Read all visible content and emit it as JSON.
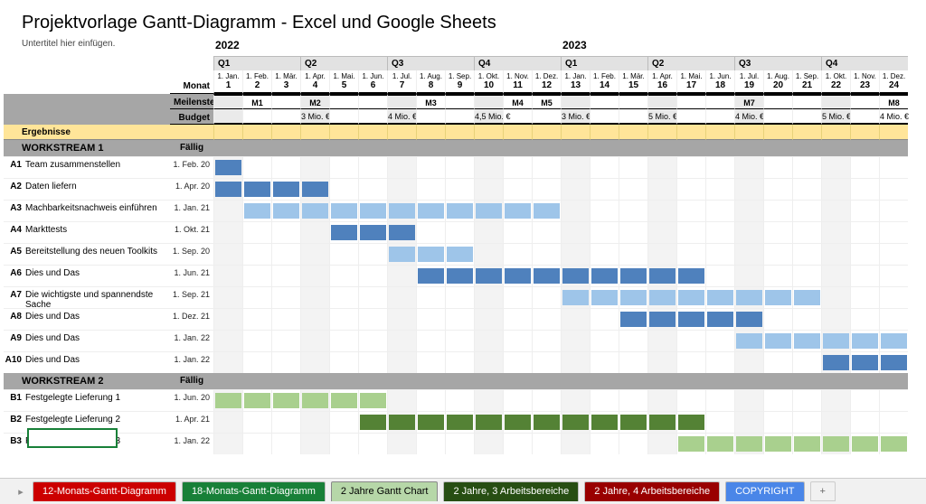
{
  "title": "Projektvorlage Gantt-Diagramm - Excel und Google Sheets",
  "subtitle": "Untertitel hier einfügen.",
  "header": {
    "monat_label": "Monat",
    "meilenstein_label": "Meilenstein",
    "budget_label": "Budget",
    "ergebnisse_label": "Ergebnisse",
    "faellig_label": "Fällig",
    "years": [
      "2022",
      "2023"
    ],
    "quarters": [
      "Q1",
      "Q2",
      "Q3",
      "Q4",
      "Q1",
      "Q2",
      "Q3",
      "Q4"
    ],
    "month_labels": [
      "1. Jan.",
      "1. Feb.",
      "1. Mär.",
      "1. Apr.",
      "1. Mai.",
      "1. Jun.",
      "1. Jul.",
      "1. Aug.",
      "1. Sep.",
      "1. Okt.",
      "1. Nov.",
      "1. Dez.",
      "1. Jan.",
      "1. Feb.",
      "1. Mär.",
      "1. Apr.",
      "1. Mai.",
      "1. Jun.",
      "1. Jul.",
      "1. Aug.",
      "1. Sep.",
      "1. Okt.",
      "1. Nov.",
      "1. Dez."
    ],
    "month_idx": [
      "1",
      "2",
      "3",
      "4",
      "5",
      "6",
      "7",
      "8",
      "9",
      "10",
      "11",
      "12",
      "13",
      "14",
      "15",
      "16",
      "17",
      "18",
      "19",
      "20",
      "21",
      "22",
      "23",
      "24"
    ]
  },
  "milestones": {
    "2": "M1",
    "4": "M2",
    "8": "M3",
    "11": "M4",
    "12": "M5",
    "19": "M7",
    "24": "M8"
  },
  "budget": {
    "4": "3 Mio. €",
    "7": "4 Mio. €",
    "10": "4,5 Mio. €",
    "13": "3 Mio. €",
    "16": "5 Mio. €",
    "19": "4 Mio. €",
    "22": "5 Mio. €",
    "24": "4 Mio. €"
  },
  "workstreams": [
    {
      "name": "WORKSTREAM 1",
      "tasks": [
        {
          "id": "A1",
          "name": "Team zusammenstellen",
          "due": "1. Feb. 20",
          "bars": [
            {
              "start": 1,
              "end": 1,
              "color": "blue-dark"
            }
          ]
        },
        {
          "id": "A2",
          "name": "Daten liefern",
          "due": "1. Apr. 20",
          "bars": [
            {
              "start": 1,
              "end": 4,
              "color": "blue-dark"
            }
          ]
        },
        {
          "id": "A3",
          "name": "Machbarkeitsnachweis einführen",
          "due": "1. Jan. 21",
          "bars": [
            {
              "start": 2,
              "end": 12,
              "color": "blue-light"
            }
          ]
        },
        {
          "id": "A4",
          "name": "Markttests",
          "due": "1. Okt. 21",
          "bars": [
            {
              "start": 5,
              "end": 7,
              "color": "blue-dark"
            }
          ]
        },
        {
          "id": "A5",
          "name": "Bereitstellung des neuen Toolkits",
          "due": "1. Sep. 20",
          "bars": [
            {
              "start": 7,
              "end": 9,
              "color": "blue-light"
            }
          ]
        },
        {
          "id": "A6",
          "name": "Dies und Das",
          "due": "1. Jun. 21",
          "bars": [
            {
              "start": 8,
              "end": 17,
              "color": "blue-dark"
            }
          ]
        },
        {
          "id": "A7",
          "name": "Die wichtigste und spannendste Sache",
          "due": "1. Sep. 21",
          "bars": [
            {
              "start": 13,
              "end": 21,
              "color": "blue-light"
            }
          ]
        },
        {
          "id": "A8",
          "name": "Dies und Das",
          "due": "1. Dez. 21",
          "bars": [
            {
              "start": 15,
              "end": 19,
              "color": "blue-dark"
            }
          ]
        },
        {
          "id": "A9",
          "name": "Dies und Das",
          "due": "1. Jan. 22",
          "bars": [
            {
              "start": 19,
              "end": 24,
              "color": "blue-light"
            }
          ]
        },
        {
          "id": "A10",
          "name": "Dies und Das",
          "due": "1. Jan. 22",
          "bars": [
            {
              "start": 22,
              "end": 24,
              "color": "blue-dark"
            }
          ]
        }
      ]
    },
    {
      "name": "WORKSTREAM 2",
      "tasks": [
        {
          "id": "B1",
          "name": "Festgelegte Lieferung 1",
          "due": "1. Jun. 20",
          "bars": [
            {
              "start": 1,
              "end": 6,
              "color": "green-light"
            }
          ]
        },
        {
          "id": "B2",
          "name": "Festgelegte Lieferung 2",
          "due": "1. Apr. 21",
          "bars": [
            {
              "start": 6,
              "end": 17,
              "color": "green-dark"
            }
          ]
        },
        {
          "id": "B3",
          "name": "Festgelegte Lieferung 3",
          "due": "1. Jan. 22",
          "bars": [
            {
              "start": 17,
              "end": 24,
              "color": "green-light"
            }
          ]
        }
      ]
    }
  ],
  "tabs": [
    {
      "label": "12-Monats-Gantt-Diagramm",
      "color": "red"
    },
    {
      "label": "18-Monats-Gantt-Diagramm",
      "color": "greenD"
    },
    {
      "label": "2 Jahre Gantt Chart",
      "color": "teal"
    },
    {
      "label": "2 Jahre, 3 Arbeitsbereiche",
      "color": "dgreen"
    },
    {
      "label": "2 Jahre, 4 Arbeitsbereiche",
      "color": "dred"
    },
    {
      "label": "COPYRIGHT",
      "color": "blue"
    }
  ],
  "chart_data": {
    "type": "gantt",
    "title": "Projektvorlage Gantt-Diagramm - Excel und Google Sheets",
    "x_axis": {
      "label": "Monat",
      "categories": [
        1,
        2,
        3,
        4,
        5,
        6,
        7,
        8,
        9,
        10,
        11,
        12,
        13,
        14,
        15,
        16,
        17,
        18,
        19,
        20,
        21,
        22,
        23,
        24
      ],
      "years": {
        "2022": [
          1,
          12
        ],
        "2023": [
          13,
          24
        ]
      }
    },
    "milestones": [
      {
        "month": 2,
        "name": "M1"
      },
      {
        "month": 4,
        "name": "M2"
      },
      {
        "month": 8,
        "name": "M3"
      },
      {
        "month": 11,
        "name": "M4"
      },
      {
        "month": 12,
        "name": "M5"
      },
      {
        "month": 19,
        "name": "M7"
      },
      {
        "month": 24,
        "name": "M8"
      }
    ],
    "budget": [
      {
        "through_month": 4,
        "value": 3,
        "unit": "Mio. €"
      },
      {
        "through_month": 7,
        "value": 4,
        "unit": "Mio. €"
      },
      {
        "through_month": 10,
        "value": 4.5,
        "unit": "Mio. €"
      },
      {
        "through_month": 13,
        "value": 3,
        "unit": "Mio. €"
      },
      {
        "through_month": 16,
        "value": 5,
        "unit": "Mio. €"
      },
      {
        "through_month": 19,
        "value": 4,
        "unit": "Mio. €"
      },
      {
        "through_month": 22,
        "value": 5,
        "unit": "Mio. €"
      },
      {
        "through_month": 24,
        "value": 4,
        "unit": "Mio. €"
      }
    ],
    "series": [
      {
        "group": "WORKSTREAM 1",
        "id": "A1",
        "name": "Team zusammenstellen",
        "due": "1. Feb. 20",
        "start": 1,
        "end": 1,
        "shade": "dark"
      },
      {
        "group": "WORKSTREAM 1",
        "id": "A2",
        "name": "Daten liefern",
        "due": "1. Apr. 20",
        "start": 1,
        "end": 4,
        "shade": "dark"
      },
      {
        "group": "WORKSTREAM 1",
        "id": "A3",
        "name": "Machbarkeitsnachweis einführen",
        "due": "1. Jan. 21",
        "start": 2,
        "end": 12,
        "shade": "light"
      },
      {
        "group": "WORKSTREAM 1",
        "id": "A4",
        "name": "Markttests",
        "due": "1. Okt. 21",
        "start": 5,
        "end": 7,
        "shade": "dark"
      },
      {
        "group": "WORKSTREAM 1",
        "id": "A5",
        "name": "Bereitstellung des neuen Toolkits",
        "due": "1. Sep. 20",
        "start": 7,
        "end": 9,
        "shade": "light"
      },
      {
        "group": "WORKSTREAM 1",
        "id": "A6",
        "name": "Dies und Das",
        "due": "1. Jun. 21",
        "start": 8,
        "end": 17,
        "shade": "dark"
      },
      {
        "group": "WORKSTREAM 1",
        "id": "A7",
        "name": "Die wichtigste und spannendste Sache",
        "due": "1. Sep. 21",
        "start": 13,
        "end": 21,
        "shade": "light"
      },
      {
        "group": "WORKSTREAM 1",
        "id": "A8",
        "name": "Dies und Das",
        "due": "1. Dez. 21",
        "start": 15,
        "end": 19,
        "shade": "dark"
      },
      {
        "group": "WORKSTREAM 1",
        "id": "A9",
        "name": "Dies und Das",
        "due": "1. Jan. 22",
        "start": 19,
        "end": 24,
        "shade": "light"
      },
      {
        "group": "WORKSTREAM 1",
        "id": "A10",
        "name": "Dies und Das",
        "due": "1. Jan. 22",
        "start": 22,
        "end": 24,
        "shade": "dark"
      },
      {
        "group": "WORKSTREAM 2",
        "id": "B1",
        "name": "Festgelegte Lieferung 1",
        "due": "1. Jun. 20",
        "start": 1,
        "end": 6,
        "shade": "light"
      },
      {
        "group": "WORKSTREAM 2",
        "id": "B2",
        "name": "Festgelegte Lieferung 2",
        "due": "1. Apr. 21",
        "start": 6,
        "end": 17,
        "shade": "dark"
      },
      {
        "group": "WORKSTREAM 2",
        "id": "B3",
        "name": "Festgelegte Lieferung 3",
        "due": "1. Jan. 22",
        "start": 17,
        "end": 24,
        "shade": "light"
      }
    ]
  }
}
